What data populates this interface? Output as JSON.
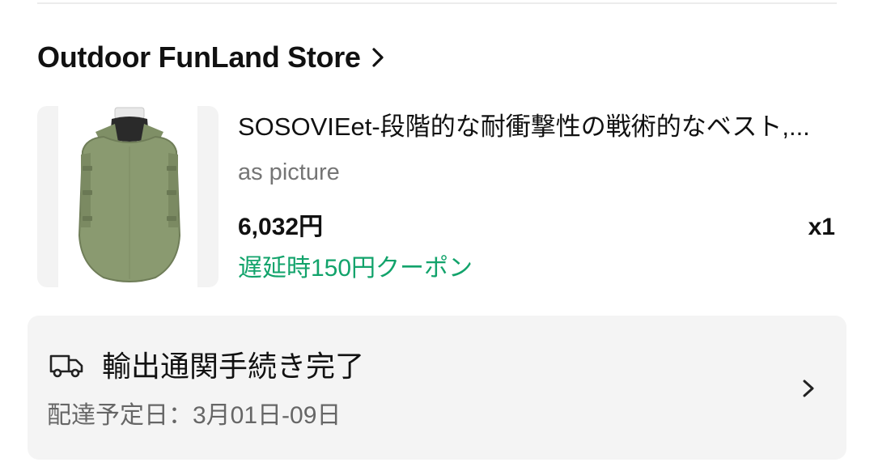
{
  "store": {
    "name": "Outdoor FunLand Store"
  },
  "product": {
    "title": "SOSOVIEet-段階的な耐衝撃性の戦術的なベスト,...",
    "variant": "as picture",
    "price": "6,032円",
    "quantity": "x1",
    "coupon": "遅延時150円クーポン"
  },
  "shipping": {
    "status": "輸出通関手続き完了",
    "delivery_estimate": "配達予定日：3月01日-09日"
  },
  "icons": {
    "store_chevron": "chevron-right-icon",
    "truck": "truck-icon",
    "shipping_chevron": "chevron-right-icon"
  },
  "colors": {
    "coupon_green": "#12a36b",
    "muted_text": "#757575",
    "card_bg": "#f4f4f4",
    "vest_green": "#8a9a70"
  }
}
